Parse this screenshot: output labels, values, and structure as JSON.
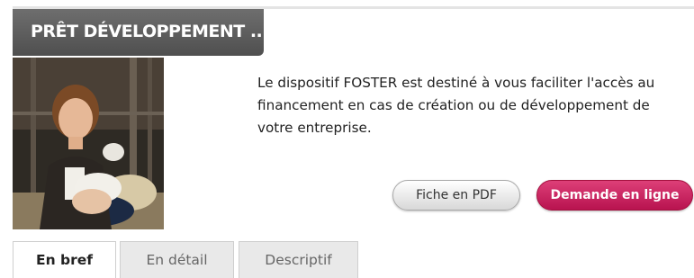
{
  "header": {
    "title": "PRÊT DÉVELOPPEMENT ..."
  },
  "intro": {
    "text": "Le dispositif FOSTER est destiné à vous faciliter l'accès au financement en cas de création ou de développement de votre entreprise."
  },
  "actions": {
    "pdf_label": "Fiche en PDF",
    "online_label": "Demande en ligne"
  },
  "tabs": [
    {
      "label": "En bref",
      "active": true
    },
    {
      "label": "En détail",
      "active": false
    },
    {
      "label": "Descriptif",
      "active": false
    }
  ],
  "colors": {
    "header_bg": "#5a5a5a",
    "accent": "#c8215e",
    "tab_inactive_bg": "#e9e9e9"
  }
}
